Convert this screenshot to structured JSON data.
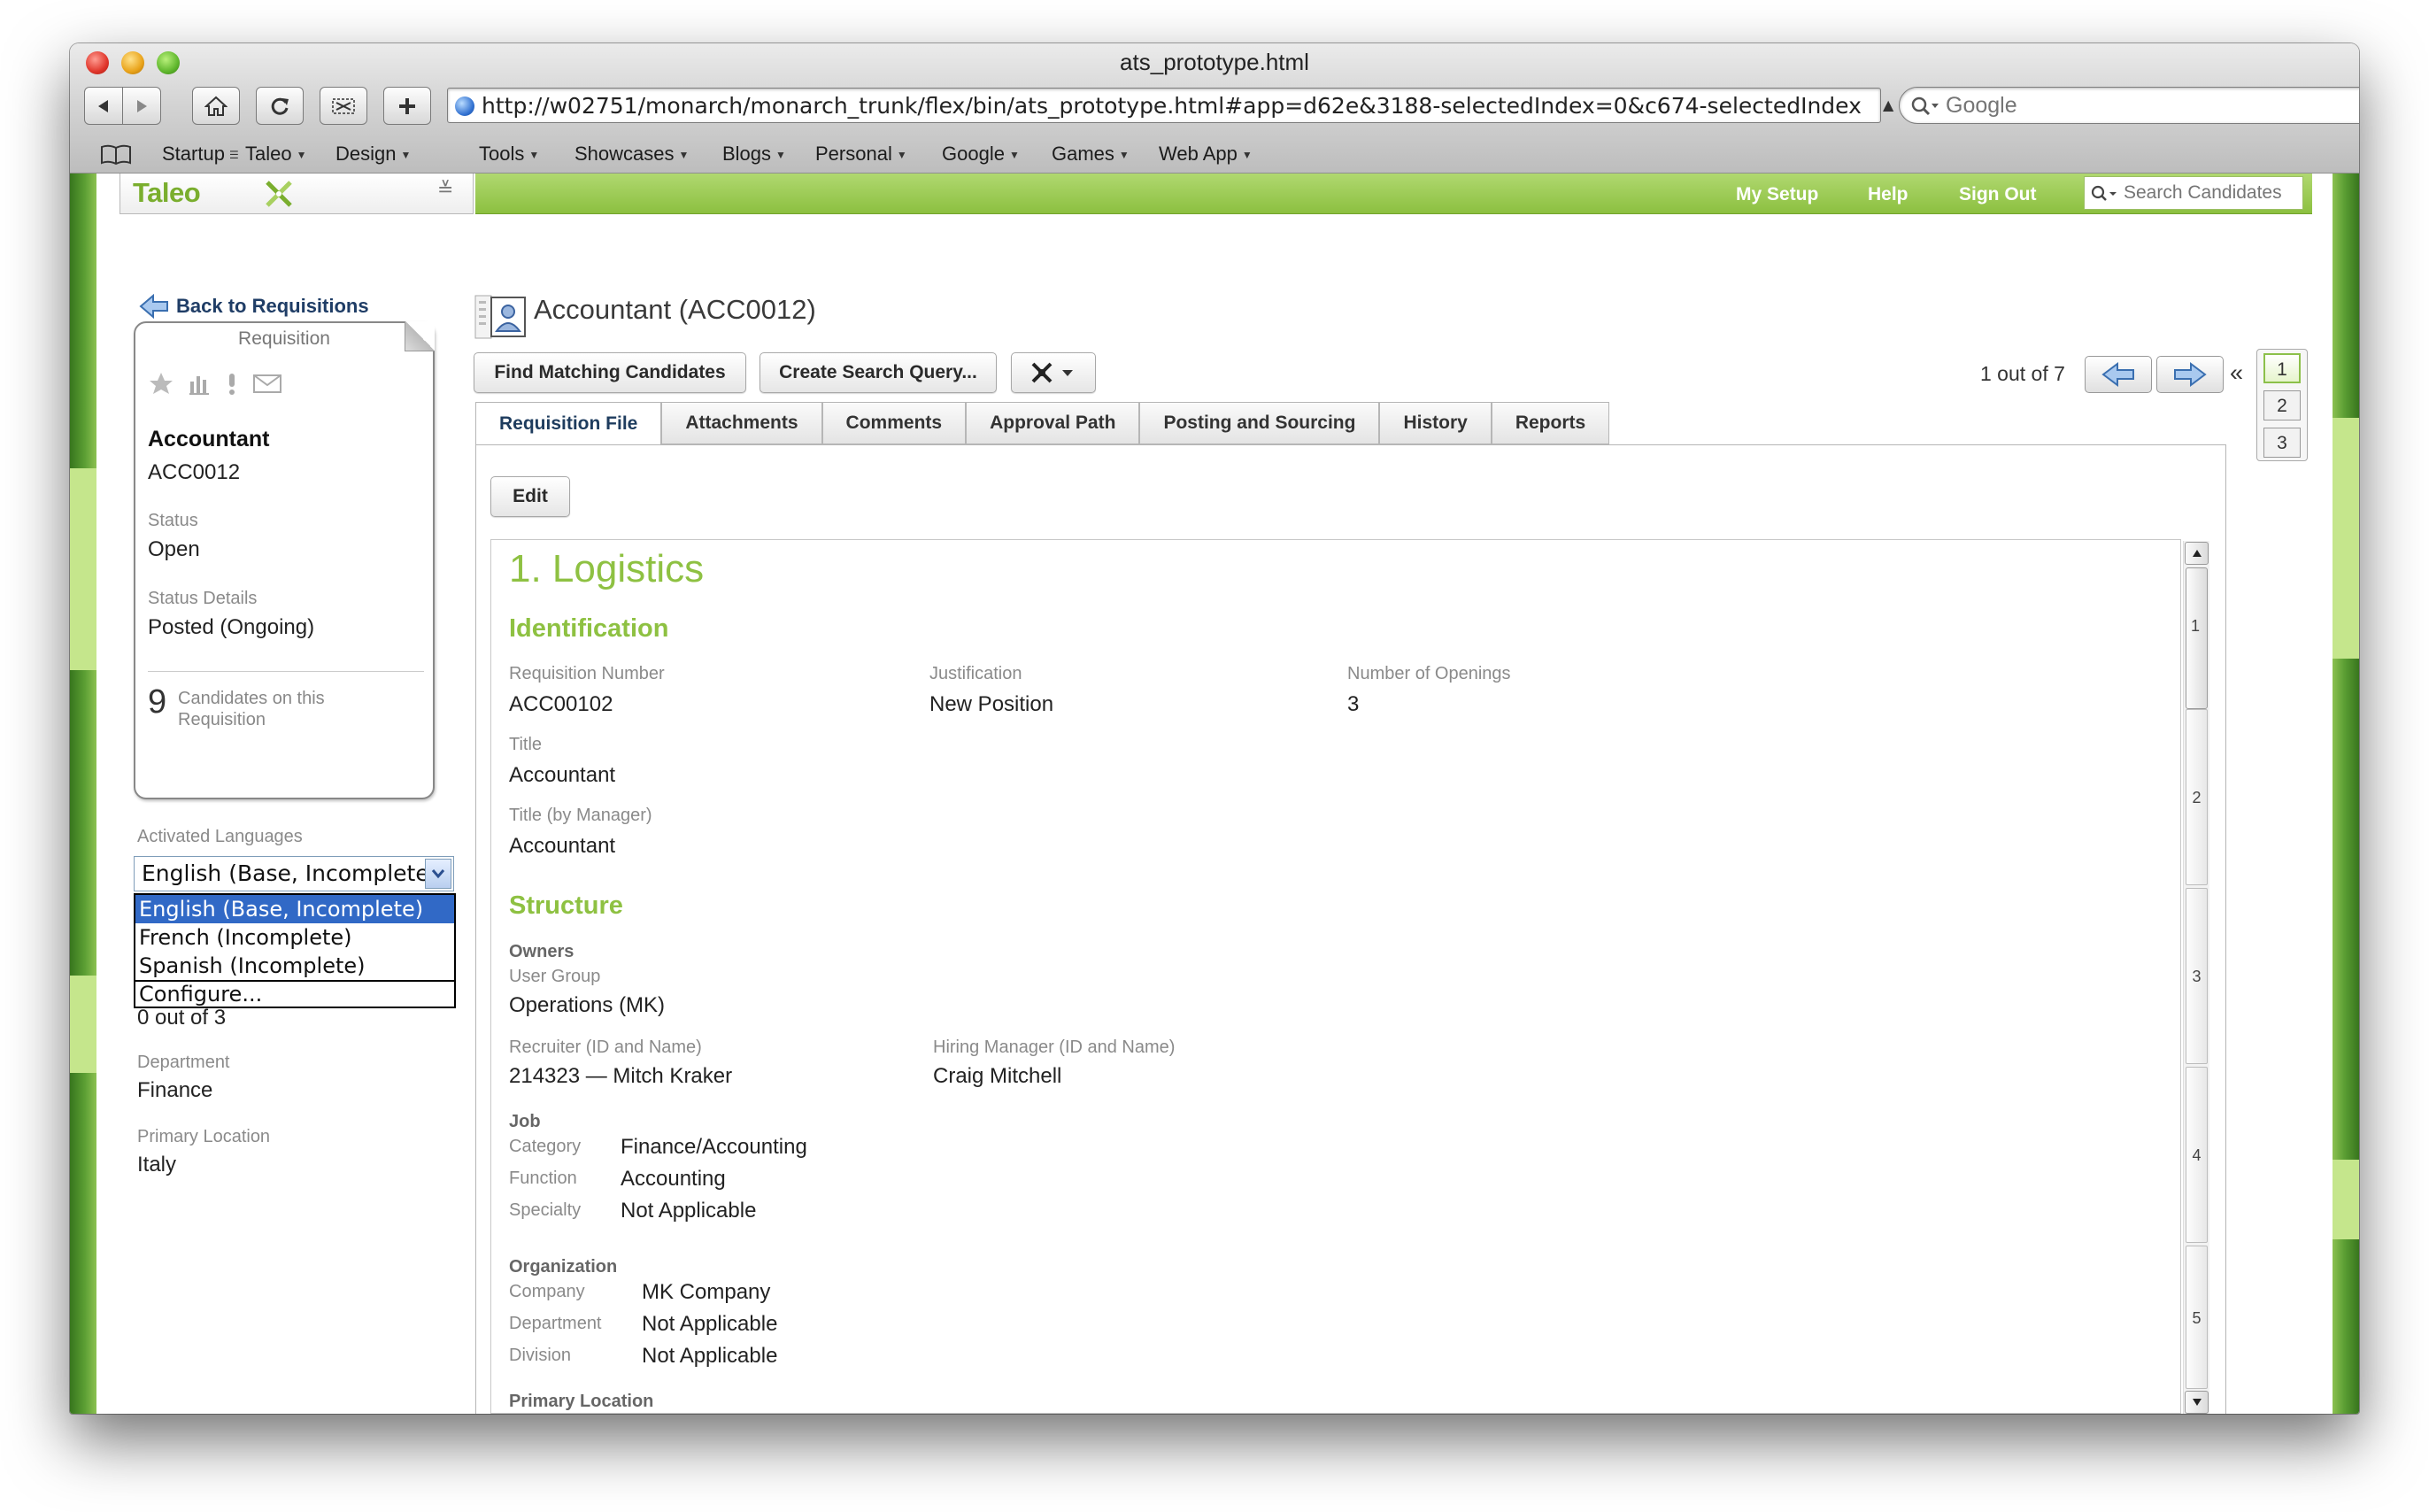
{
  "browser": {
    "window_title": "ats_prototype.html",
    "url": "http://w02751/monarch/monarch_trunk/flex/bin/ats_prototype.html#app=d62e&3188-selectedIndex=0&c674-selectedIndex",
    "search_placeholder": "Google",
    "bookmarks": [
      "Startup",
      "Taleo",
      "Design",
      "Tools",
      "Showcases",
      "Blogs",
      "Personal",
      "Google",
      "Games",
      "Web App"
    ]
  },
  "app": {
    "logo": "Taleo",
    "nav": {
      "my_setup": "My Setup",
      "help": "Help",
      "sign_out": "Sign Out",
      "search_placeholder": "Search Candidates"
    },
    "colors": {
      "accent": "#8ec142",
      "brand_green": "#8cc040"
    }
  },
  "sidebar": {
    "back_link": "Back to Requisitions",
    "card": {
      "header": "Requisition",
      "title": "Accountant",
      "code": "ACC0012",
      "status_label": "Status",
      "status": "Open",
      "status_details_label": "Status Details",
      "status_details": "Posted (Ongoing)",
      "candidates_count": "9",
      "candidates_label": "Candidates on this Requisition"
    },
    "languages_label": "Activated Languages",
    "languages_selected": "English (Base, Incomplete)",
    "languages_options": [
      "English (Base, Incomplete)",
      "French (Incomplete)",
      "Spanish (Incomplete)"
    ],
    "languages_configure": "Configure...",
    "partial_text": "0 out of 3",
    "department_label": "Department",
    "department": "Finance",
    "location_label": "Primary Location",
    "location": "Italy"
  },
  "main": {
    "title": "Accountant (ACC0012)",
    "buttons": {
      "find": "Find Matching Candidates",
      "create": "Create Search Query...",
      "edit": "Edit"
    },
    "pager": {
      "text": "1 out of 7",
      "collapse": "«",
      "pages": [
        "1",
        "2",
        "3"
      ]
    },
    "tabs": [
      "Requisition File",
      "Attachments",
      "Comments",
      "Approval Path",
      "Posting and Sourcing",
      "History",
      "Reports"
    ]
  },
  "form": {
    "section": "1. Logistics",
    "identification": {
      "heading": "Identification",
      "req_number_label": "Requisition Number",
      "req_number": "ACC00102",
      "justification_label": "Justification",
      "justification": "New Position",
      "openings_label": "Number of Openings",
      "openings": "3",
      "title_label": "Title",
      "title": "Accountant",
      "title_mgr_label": "Title (by Manager)",
      "title_mgr": "Accountant"
    },
    "structure": {
      "heading": "Structure",
      "owners": "Owners",
      "user_group_label": "User Group",
      "user_group": "Operations (MK)",
      "recruiter_label": "Recruiter (ID and Name)",
      "recruiter": "214323 — Mitch Kraker",
      "hiring_mgr_label": "Hiring Manager (ID and Name)",
      "hiring_mgr": "Craig Mitchell",
      "job": "Job",
      "category_label": "Category",
      "category": "Finance/Accounting",
      "function_label": "Function",
      "function": "Accounting",
      "specialty_label": "Specialty",
      "specialty": "Not Applicable",
      "organization": "Organization",
      "company_label": "Company",
      "company": "MK Company",
      "department_label": "Department",
      "department": "Not Applicable",
      "division_label": "Division",
      "division": "Not Applicable",
      "primary_location": "Primary Location"
    },
    "scroll_markers": [
      "1",
      "2",
      "3",
      "4",
      "5"
    ]
  }
}
